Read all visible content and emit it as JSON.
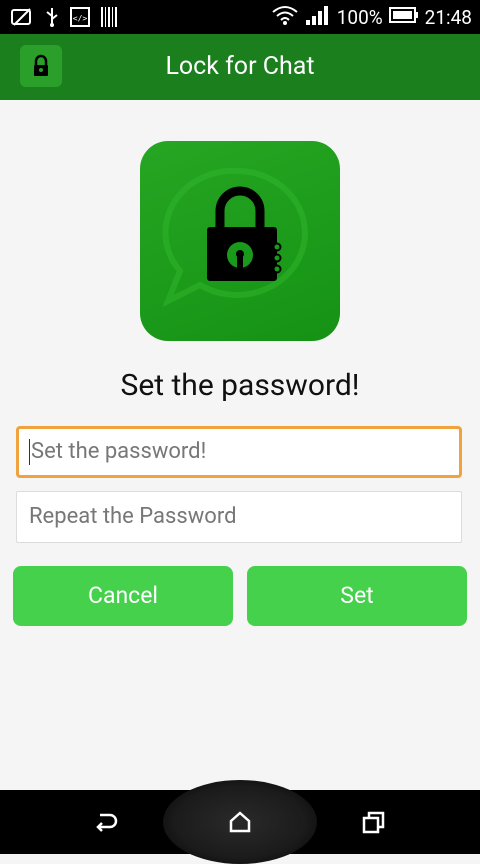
{
  "status_bar": {
    "battery_percent": "100%",
    "time": "21:48"
  },
  "app_bar": {
    "title": "Lock for Chat"
  },
  "main": {
    "heading": "Set the password!",
    "password_field": {
      "placeholder": "Set the password!",
      "value": ""
    },
    "repeat_field": {
      "placeholder": "Repeat the Password",
      "value": ""
    },
    "cancel_label": "Cancel",
    "set_label": "Set"
  },
  "colors": {
    "app_bar": "#1b7f1d",
    "button": "#46d14d",
    "focus_border": "#f0a33c"
  }
}
